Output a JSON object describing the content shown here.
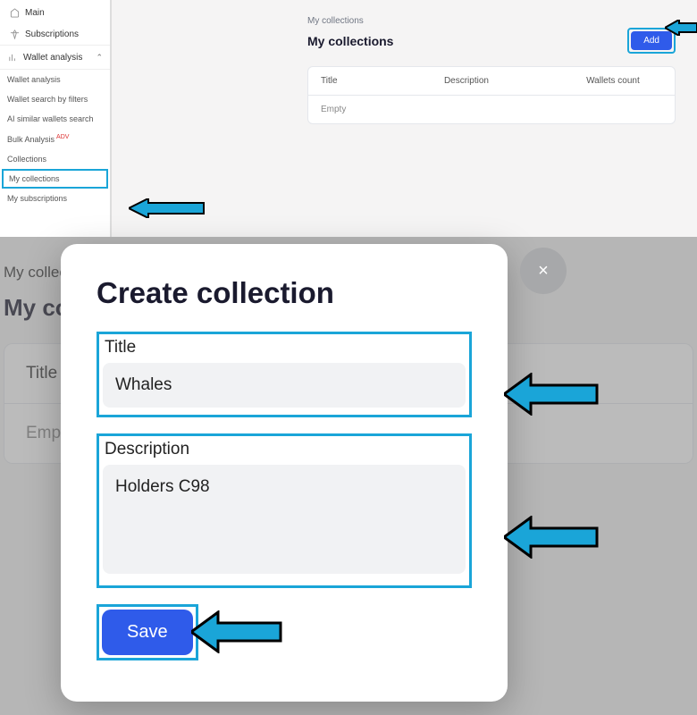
{
  "sidebar": {
    "main": "Main",
    "subscriptions": "Subscriptions",
    "wallet_analysis_section": "Wallet analysis",
    "items": [
      "Wallet analysis",
      "Wallet search by filters",
      "AI similar wallets search",
      "Bulk Analysis",
      "Collections",
      "My collections",
      "My subscriptions"
    ],
    "bulk_tag": "ADV"
  },
  "top": {
    "breadcrumb": "My collections",
    "title": "My collections",
    "add_label": "Add",
    "table": {
      "col_title": "Title",
      "col_description": "Description",
      "col_count": "Wallets count",
      "empty": "Empty"
    }
  },
  "bg": {
    "breadcrumb": "My collections",
    "title": "My collections",
    "col_title": "Title",
    "empty": "Empty"
  },
  "modal": {
    "title": "Create collection",
    "title_label": "Title",
    "title_value": "Whales",
    "description_label": "Description",
    "description_value": "Holders C98",
    "save_label": "Save",
    "close_label": "×"
  }
}
